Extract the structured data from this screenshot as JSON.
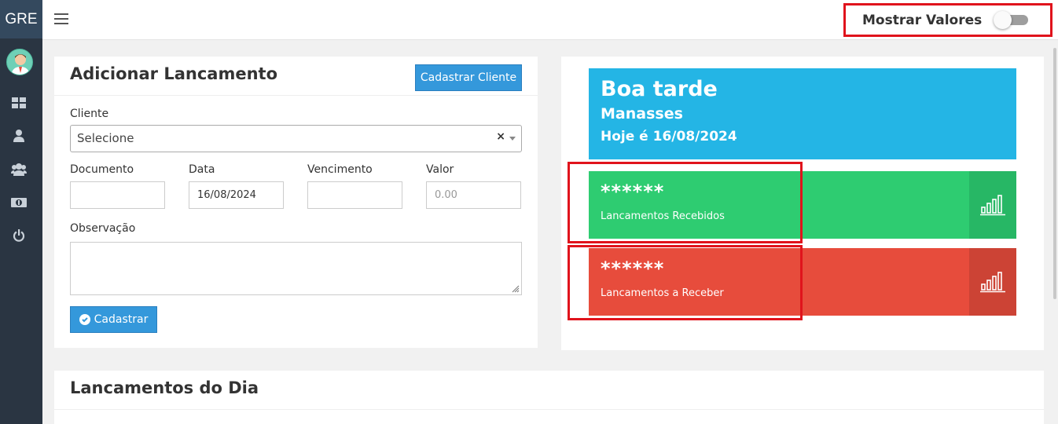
{
  "brand": "GRE",
  "topbar": {
    "show_values_label": "Mostrar Valores",
    "show_values_on": false
  },
  "sidebar": {
    "items": [
      {
        "icon": "dashboard-icon"
      },
      {
        "icon": "user-icon"
      },
      {
        "icon": "users-icon"
      },
      {
        "icon": "money-icon"
      },
      {
        "icon": "power-icon"
      }
    ]
  },
  "form": {
    "title": "Adicionar Lancamento",
    "register_client_label": "Cadastrar Cliente",
    "client_label": "Cliente",
    "client_value": "Selecione",
    "client_clear": "×",
    "document_label": "Documento",
    "document_value": "",
    "date_label": "Data",
    "date_value": "16/08/2024",
    "due_label": "Vencimento",
    "due_value": "",
    "value_label": "Valor",
    "value_placeholder": "0.00",
    "note_label": "Observação",
    "submit_label": "Cadastrar"
  },
  "summary": {
    "greeting": "Boa tarde",
    "user": "Manasses",
    "today": "Hoje é 16/08/2024",
    "received_amount": "******",
    "received_label": "Lancamentos Recebidos",
    "receivable_amount": "******",
    "receivable_label": "Lancamentos a Receber"
  },
  "daily": {
    "title": "Lancamentos do Dia"
  },
  "colors": {
    "sidebar": "#2a3542",
    "primary": "#3498db",
    "info": "#24b5e5",
    "success": "#2ecc71",
    "danger": "#e74c3c",
    "highlight": "#e0131c"
  }
}
